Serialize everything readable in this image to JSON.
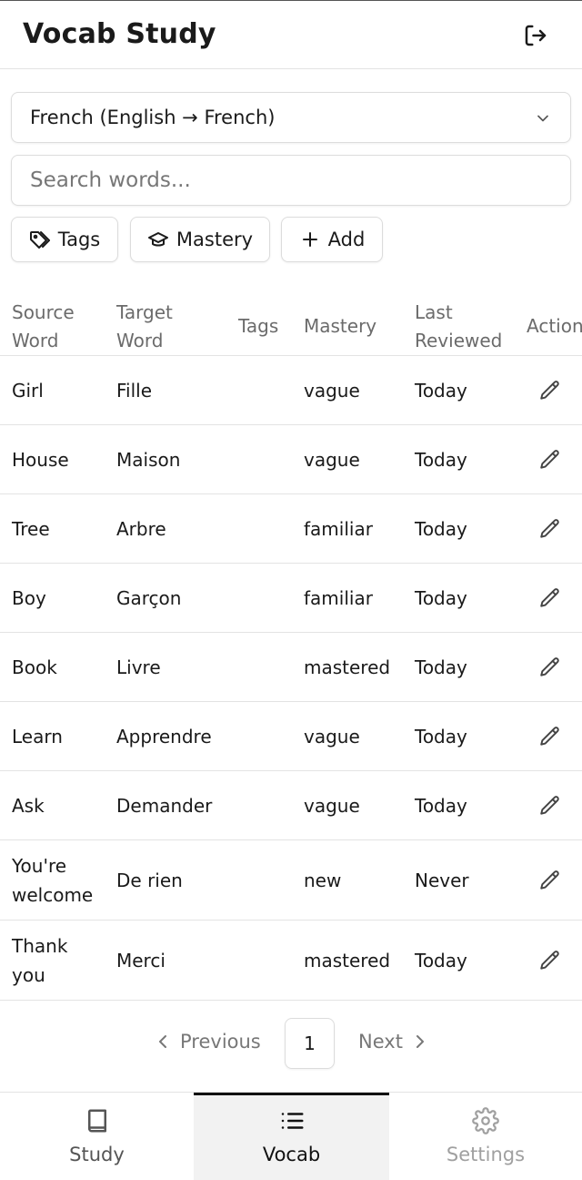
{
  "header": {
    "title": "Vocab Study",
    "logout_icon": "logout-icon"
  },
  "language_select": {
    "value": "French (English → French)",
    "icon": "chevron-down-icon"
  },
  "search": {
    "placeholder": "Search words..."
  },
  "filters": [
    {
      "label": "Tags",
      "icon": "tag-icon"
    },
    {
      "label": "Mastery",
      "icon": "graduation-cap-icon"
    },
    {
      "label": "Add",
      "icon": "plus-icon"
    }
  ],
  "table": {
    "columns": [
      "Source Word",
      "Target Word",
      "Tags",
      "Mastery",
      "Last Reviewed",
      "Actions"
    ],
    "rows": [
      {
        "source": "Girl",
        "target": "Fille",
        "tags": "",
        "mastery": "vague",
        "last_reviewed": "Today"
      },
      {
        "source": "House",
        "target": "Maison",
        "tags": "",
        "mastery": "vague",
        "last_reviewed": "Today"
      },
      {
        "source": "Tree",
        "target": "Arbre",
        "tags": "",
        "mastery": "familiar",
        "last_reviewed": "Today"
      },
      {
        "source": "Boy",
        "target": "Garçon",
        "tags": "",
        "mastery": "familiar",
        "last_reviewed": "Today"
      },
      {
        "source": "Book",
        "target": "Livre",
        "tags": "",
        "mastery": "mastered",
        "last_reviewed": "Today"
      },
      {
        "source": "Learn",
        "target": "Apprendre",
        "tags": "",
        "mastery": "vague",
        "last_reviewed": "Today"
      },
      {
        "source": "Ask",
        "target": "Demander",
        "tags": "",
        "mastery": "vague",
        "last_reviewed": "Today"
      },
      {
        "source": "You're welcome",
        "target": "De rien",
        "tags": "",
        "mastery": "new",
        "last_reviewed": "Never"
      },
      {
        "source": "Thank you",
        "target": "Merci",
        "tags": "",
        "mastery": "mastered",
        "last_reviewed": "Today"
      }
    ]
  },
  "pagination": {
    "previous_label": "Previous",
    "current_page": "1",
    "next_label": "Next"
  },
  "bottom_nav": [
    {
      "label": "Study",
      "icon": "book-icon",
      "active": false
    },
    {
      "label": "Vocab",
      "icon": "list-icon",
      "active": true
    },
    {
      "label": "Settings",
      "icon": "gear-icon",
      "active": false
    }
  ],
  "colors": {
    "text": "#1a1a1a",
    "muted": "#6b6b6b",
    "border": "#dcdcdc",
    "active_tab_bg": "#f2f2f2",
    "disabled": "#a0a0a0"
  }
}
